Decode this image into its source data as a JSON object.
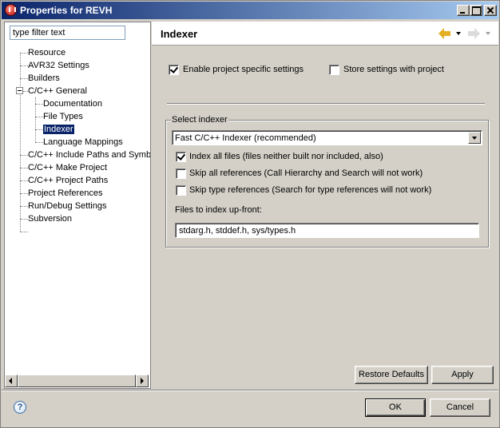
{
  "window": {
    "title": "Properties for REVH",
    "icon": "app-icon",
    "buttons": [
      "minimize-icon",
      "maximize-icon",
      "close-icon"
    ]
  },
  "filter": {
    "value": "type filter text"
  },
  "tree": {
    "items": [
      {
        "label": "Resource",
        "level": 0
      },
      {
        "label": "AVR32 Settings",
        "level": 0
      },
      {
        "label": "Builders",
        "level": 0
      },
      {
        "label": "C/C++ General",
        "level": 0,
        "expanded": true
      },
      {
        "label": "Documentation",
        "level": 1
      },
      {
        "label": "File Types",
        "level": 1
      },
      {
        "label": "Indexer",
        "level": 1,
        "selected": true
      },
      {
        "label": "Language Mappings",
        "level": 1
      },
      {
        "label": "C/C++ Include Paths and Symb",
        "level": 0
      },
      {
        "label": "C/C++ Make Project",
        "level": 0
      },
      {
        "label": "C/C++ Project Paths",
        "level": 0
      },
      {
        "label": "Project References",
        "level": 0
      },
      {
        "label": "Run/Debug Settings",
        "level": 0
      },
      {
        "label": "Subversion",
        "level": 0
      }
    ]
  },
  "page": {
    "title": "Indexer",
    "nav_icons": [
      "back-arrow-icon",
      "forward-arrow-icon"
    ]
  },
  "settings": {
    "enable_project_specific": {
      "label": "Enable project specific settings",
      "checked": true
    },
    "store_with_project": {
      "label": "Store settings with project",
      "checked": false
    }
  },
  "indexer": {
    "group_label": "Select indexer",
    "selected": "Fast C/C++ Indexer (recommended)",
    "index_all_files": {
      "label": "Index all files (files neither built nor included, also)",
      "checked": true
    },
    "skip_all_refs": {
      "label": "Skip all references (Call Hierarchy and Search will not work)",
      "checked": false
    },
    "skip_type_refs": {
      "label": "Skip type references (Search for type references will not work)",
      "checked": false
    },
    "files_label": "Files to index up-front:",
    "files_value": "stdarg.h, stddef.h, sys/types.h"
  },
  "buttons": {
    "restore_defaults": "Restore Defaults",
    "apply": "Apply",
    "ok": "OK",
    "cancel": "Cancel"
  },
  "colors": {
    "selection": "#0a246a",
    "dialog_bg": "#d4d0c8"
  }
}
